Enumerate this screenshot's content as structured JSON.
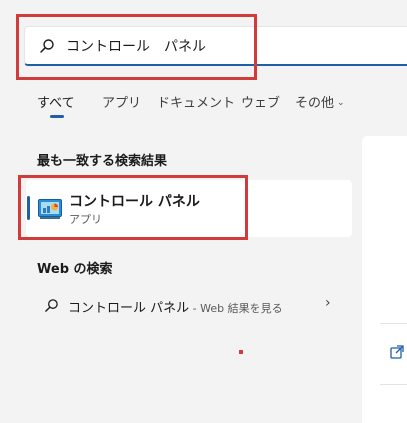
{
  "search": {
    "value": "コントロール　パネル"
  },
  "tabs": [
    {
      "label": "すべて",
      "active": true
    },
    {
      "label": "アプリ"
    },
    {
      "label": "ドキュメント"
    },
    {
      "label": "ウェブ"
    },
    {
      "label": "その他"
    }
  ],
  "best_match": {
    "heading": "最も一致する検索結果",
    "name": "コントロール パネル",
    "kind": "アプリ"
  },
  "web": {
    "heading": "Web の検索",
    "query": "コントロール パネル",
    "suffix": " - Web 結果を見る"
  },
  "colors": {
    "accent": "#1f5fa8",
    "highlight": "#d03b3b"
  },
  "icons": {
    "search": "search-icon",
    "more": "chevron-down-icon",
    "app": "control-panel-icon",
    "arrow": "chevron-right-icon",
    "open": "open-external-icon"
  }
}
